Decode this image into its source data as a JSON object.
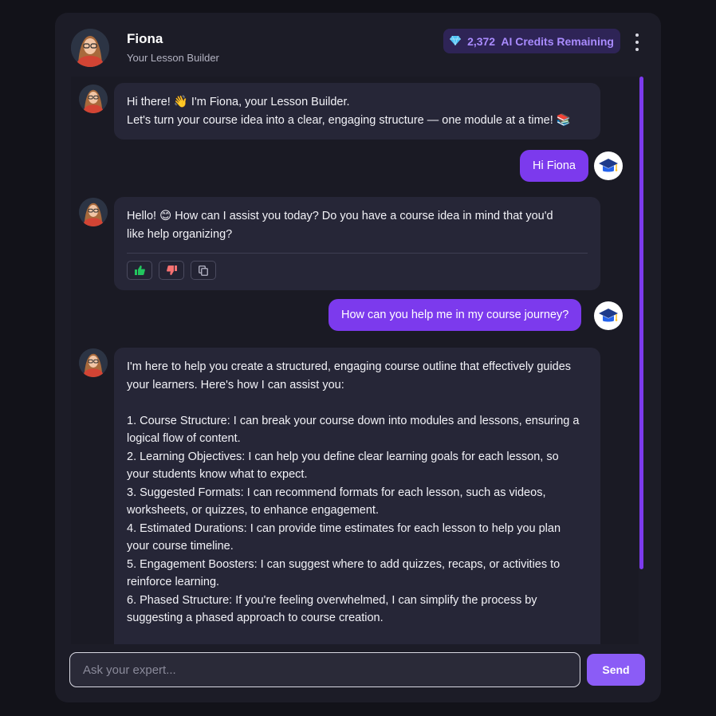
{
  "header": {
    "name": "Fiona",
    "subtitle": "Your Lesson Builder",
    "credits": "2,372  AI Credits Remaining"
  },
  "messages": [
    {
      "role": "bot",
      "lines": [
        "Hi there!  👋 I'm Fiona, your Lesson Builder.",
        "Let's turn your course idea into a clear, engaging structure — one module at a time! 📚"
      ]
    },
    {
      "role": "user",
      "text": "Hi Fiona"
    },
    {
      "role": "bot",
      "lines": [
        "Hello! 😊 How can I assist you today? Do you have a course idea in mind that you'd",
        "like help organizing?"
      ]
    },
    {
      "role": "user",
      "text": "How can you help me in my course journey?"
    },
    {
      "role": "bot",
      "lines": [
        "I'm here to help you create a structured, engaging course outline that effectively guides",
        "your learners. Here's how I can assist you:",
        "",
        "1. Course Structure: I can break your course down into modules and lessons, ensuring a",
        "logical flow of content.",
        "2. Learning Objectives: I can help you define clear learning goals for each lesson, so",
        "your students know what to expect.",
        "3. Suggested Formats: I can recommend formats for each lesson, such as videos,",
        "worksheets, or quizzes, to enhance engagement.",
        "4. Estimated Durations: I can provide time estimates for each lesson to help you plan",
        "your course timeline.",
        "5. Engagement Boosters: I can suggest where to add quizzes, recaps, or activities to",
        "reinforce learning.",
        "6. Phased Structure: If you're feeling overwhelmed, I can simplify the process by",
        "suggesting a phased approach to course creation."
      ]
    }
  ],
  "composer": {
    "placeholder": "Ask your expert...",
    "send_label": "Send"
  },
  "colors": {
    "accent": "#7c3aed",
    "send": "#8b5cf6",
    "credits_text": "#a98bff",
    "like": "#22c55e",
    "dislike": "#f87171"
  },
  "icons": [
    "diamond-icon",
    "more-vertical-icon",
    "thumbs-up-icon",
    "thumbs-down-icon",
    "copy-icon",
    "graduation-cap-icon"
  ]
}
